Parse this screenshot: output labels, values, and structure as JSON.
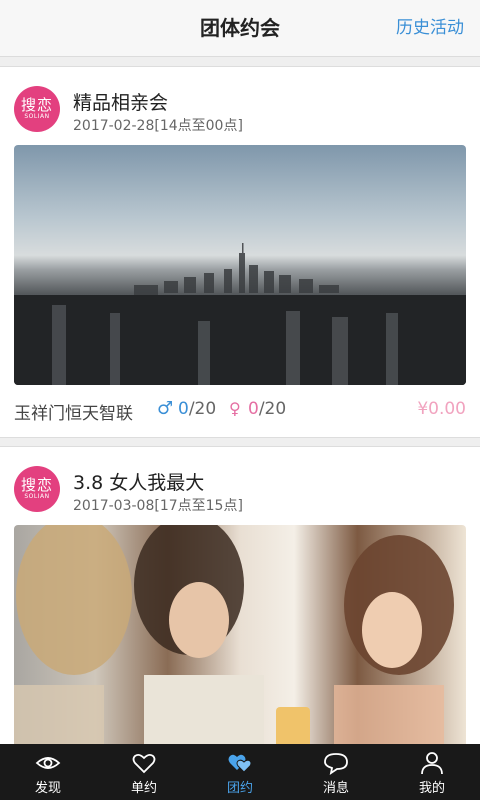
{
  "header": {
    "title": "团体约会",
    "history_link": "历史活动"
  },
  "events": [
    {
      "logo": {
        "cn": "搜恋",
        "en": "SOLIAN"
      },
      "title": "精品相亲会",
      "date": "2017-02-28[14点至00点]",
      "location": "玉祥门恒天智联",
      "male_current": "0",
      "male_total": "/20",
      "female_current": "0",
      "female_total": "/20",
      "price": "¥0.00"
    },
    {
      "logo": {
        "cn": "搜恋",
        "en": "SOLIAN"
      },
      "title": "3.8 女人我最大",
      "date": "2017-03-08[17点至15点]"
    }
  ],
  "tabbar": {
    "items": [
      {
        "label": "发现",
        "icon": "eye-icon",
        "active": false
      },
      {
        "label": "单约",
        "icon": "heart-icon",
        "active": false
      },
      {
        "label": "团约",
        "icon": "hearts-icon",
        "active": true
      },
      {
        "label": "消息",
        "icon": "chat-bubble-icon",
        "active": false
      },
      {
        "label": "我的",
        "icon": "person-icon",
        "active": false
      }
    ],
    "active_color": "#4aa3ea"
  }
}
